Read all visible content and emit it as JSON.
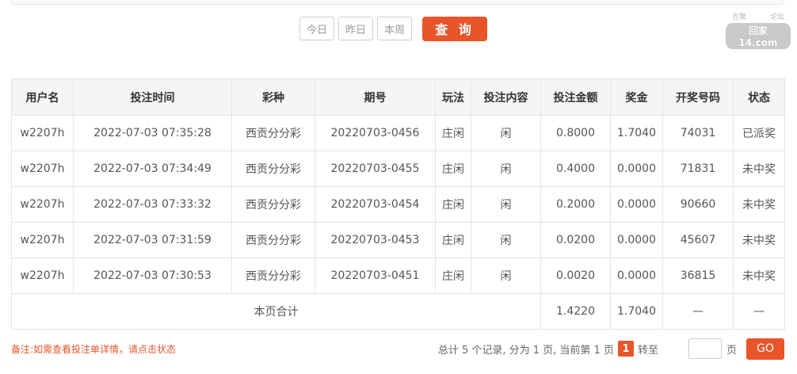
{
  "filters": {
    "today": "今日",
    "yesterday": "昨日",
    "this_week": "本周",
    "query": "查 询"
  },
  "watermark": {
    "left": "吉聚",
    "right": "论坛",
    "main": "回家14.com"
  },
  "table": {
    "headers": [
      "用户名",
      "投注时间",
      "彩种",
      "期号",
      "玩法",
      "投注内容",
      "投注金额",
      "奖金",
      "开奖号码",
      "状态"
    ],
    "rows": [
      {
        "user": "w2207h",
        "time": "2022-07-03 07:35:28",
        "lottery": "西贡分分彩",
        "issue": "20220703-0456",
        "play": "庄闲",
        "content": "闲",
        "amount": "0.8000",
        "prize": "1.7040",
        "draw": "74031",
        "status": "已派奖"
      },
      {
        "user": "w2207h",
        "time": "2022-07-03 07:34:49",
        "lottery": "西贡分分彩",
        "issue": "20220703-0455",
        "play": "庄闲",
        "content": "闲",
        "amount": "0.4000",
        "prize": "0.0000",
        "draw": "71831",
        "status": "未中奖"
      },
      {
        "user": "w2207h",
        "time": "2022-07-03 07:33:32",
        "lottery": "西贡分分彩",
        "issue": "20220703-0454",
        "play": "庄闲",
        "content": "闲",
        "amount": "0.2000",
        "prize": "0.0000",
        "draw": "90660",
        "status": "未中奖"
      },
      {
        "user": "w2207h",
        "time": "2022-07-03 07:31:59",
        "lottery": "西贡分分彩",
        "issue": "20220703-0453",
        "play": "庄闲",
        "content": "闲",
        "amount": "0.0200",
        "prize": "0.0000",
        "draw": "45607",
        "status": "未中奖"
      },
      {
        "user": "w2207h",
        "time": "2022-07-03 07:30:53",
        "lottery": "西贡分分彩",
        "issue": "20220703-0451",
        "play": "庄闲",
        "content": "闲",
        "amount": "0.0020",
        "prize": "0.0000",
        "draw": "36815",
        "status": "未中奖"
      }
    ],
    "summary": {
      "label": "本页合计",
      "amount": "1.4220",
      "prize": "1.7040",
      "draw": "—",
      "status": "—"
    }
  },
  "footer": {
    "note": "备注:如需查看投注单详情，请点击状态",
    "pager_text": "总计 5 个记录, 分为 1 页, 当前第 1 页",
    "current_page": "1",
    "goto_label": "转至",
    "goto_value": "",
    "page_unit": "页",
    "go": "GO"
  },
  "colors": {
    "accent": "#e8552a",
    "header_bg": "#f5f5f5",
    "border": "#e4e4e4"
  }
}
